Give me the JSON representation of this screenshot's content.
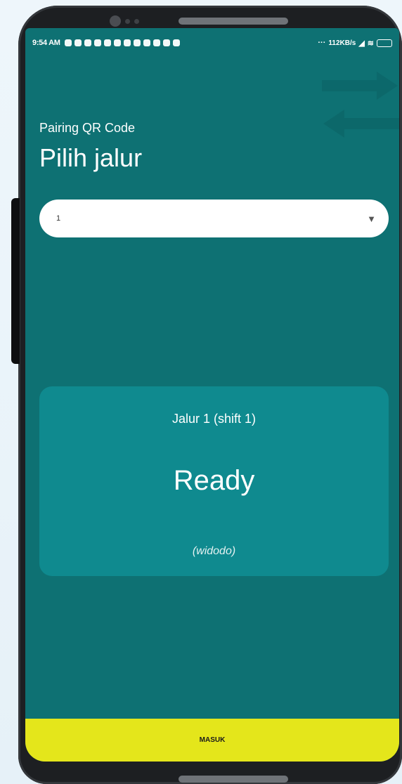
{
  "status_bar": {
    "time": "9:54 AM",
    "net_speed": "112KB/s",
    "notification_icons": [
      "whatsapp-icon",
      "facebook-icon",
      "facebook-icon",
      "instagram-icon",
      "app-icon",
      "app-icon",
      "app-icon",
      "app-icon",
      "app-icon",
      "app-icon",
      "app-icon",
      "app-icon"
    ]
  },
  "header": {
    "subtitle": "Pairing QR Code",
    "title": "Pilih jalur"
  },
  "line_select": {
    "selected_value": "1"
  },
  "status_card": {
    "line_label": "Jalur 1 (shift 1)",
    "status": "Ready",
    "operator": "(widodo)"
  },
  "actions": {
    "submit_label": "MASUK"
  },
  "colors": {
    "screen_background": "#0e7173",
    "card_background": "#0f8a8f",
    "button_background": "#e4e61b"
  }
}
